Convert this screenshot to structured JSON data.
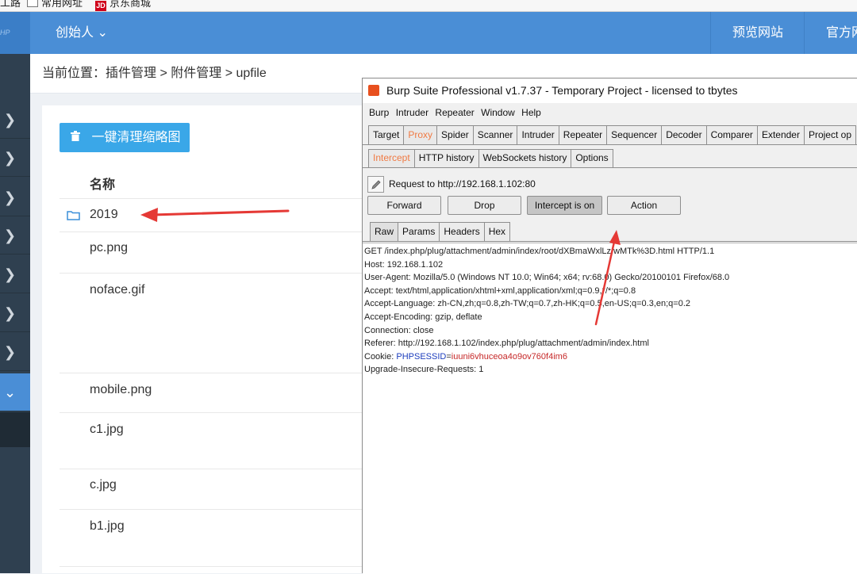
{
  "bookmarks": {
    "item0": "工路",
    "item1": "常用网址",
    "item2": "京东商城",
    "jd_badge": "JD"
  },
  "header": {
    "logo": "HP",
    "founder": "创始人",
    "preview_site": "预览网站",
    "official_site": "官方网",
    "color": "#4a8ed6"
  },
  "breadcrumb": {
    "prefix": "当前位置：",
    "path": "插件管理 > 附件管理 > upfile"
  },
  "main": {
    "clean_button": "一键清理缩略图",
    "column_name": "名称",
    "files": [
      "2019",
      "pc.png",
      "noface.gif",
      "mobile.png",
      "c1.jpg",
      "c.jpg",
      "b1.jpg"
    ]
  },
  "burp": {
    "title": "Burp Suite Professional v1.7.37 - Temporary Project - licensed to tbytes",
    "menu": [
      "Burp",
      "Intruder",
      "Repeater",
      "Window",
      "Help"
    ],
    "main_tabs": [
      "Target",
      "Proxy",
      "Spider",
      "Scanner",
      "Intruder",
      "Repeater",
      "Sequencer",
      "Decoder",
      "Comparer",
      "Extender",
      "Project op"
    ],
    "main_tab_selected": "Proxy",
    "proxy_tabs": [
      "Intercept",
      "HTTP history",
      "WebSockets history",
      "Options"
    ],
    "proxy_tab_selected": "Intercept",
    "request_to": "Request to http://192.168.1.102:80",
    "buttons": {
      "forward": "Forward",
      "drop": "Drop",
      "intercept": "Intercept is on",
      "action": "Action"
    },
    "view_tabs": [
      "Raw",
      "Params",
      "Headers",
      "Hex"
    ],
    "view_tab_selected": "Raw",
    "raw_lines": [
      "GET /index.php/plug/attachment/admin/index/root/dXBmaWxlLzIwMTk%3D.html HTTP/1.1",
      "Host: 192.168.1.102",
      "User-Agent: Mozilla/5.0 (Windows NT 10.0; Win64; x64; rv:68.0) Gecko/20100101 Firefox/68.0",
      "Accept: text/html,application/xhtml+xml,application/xml;q=0.9,*/*;q=0.8",
      "Accept-Language: zh-CN,zh;q=0.8,zh-TW;q=0.7,zh-HK;q=0.5,en-US;q=0.3,en;q=0.2",
      "Accept-Encoding: gzip, deflate",
      "Connection: close",
      "Referer: http://192.168.1.102/index.php/plug/attachment/admin/index.html"
    ],
    "cookie": {
      "label": "Cookie: ",
      "key": "PHPSESSID",
      "eq": "=",
      "value": "iuuni6vhuceoa4o9ov760f4im6"
    },
    "last_line": "Upgrade-Insecure-Requests: 1",
    "accent_color": "#f07a43"
  },
  "annotation_color": "#e53935"
}
